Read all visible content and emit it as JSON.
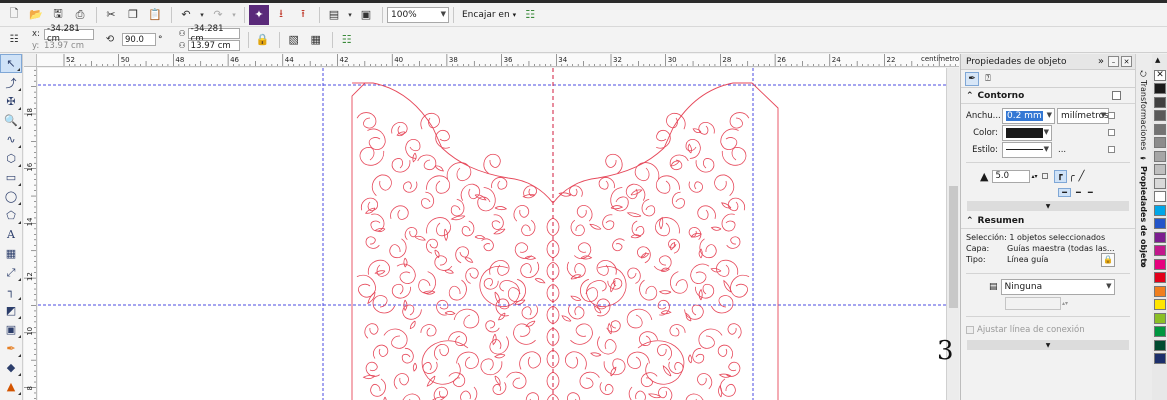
{
  "toolbar": {
    "zoom_value": "100%",
    "snap_label": "Encajar en"
  },
  "propbar": {
    "x_label": "x:",
    "x_value": "-34.281 cm",
    "y_label": "y:",
    "y_value": "13.97 cm",
    "angle_value": "90.0",
    "angle_unit": "°",
    "p1_value": "-34.281 cm",
    "p2_value": "13.97 cm"
  },
  "ruler": {
    "h_labels": [
      "52",
      "50",
      "48",
      "46",
      "44",
      "42",
      "40",
      "38",
      "36",
      "34",
      "32",
      "30",
      "28",
      "26",
      "24",
      "22"
    ],
    "unit": "centímetros",
    "v_labels": [
      "18",
      "16",
      "14",
      "12",
      "10",
      "8",
      "6"
    ]
  },
  "canvas": {
    "big_char": "3"
  },
  "docker": {
    "title": "Propiedades de objeto",
    "contorno": {
      "heading": "Contorno",
      "width_label": "Anchu...",
      "width_value": "0.2 mm",
      "unit_value": "milímetros",
      "color_label": "Color:",
      "style_label": "Estilo:",
      "style_more": "...",
      "miter_value": "5.0"
    },
    "resumen": {
      "heading": "Resumen",
      "selection_text": "Selección: 1 objetos seleccionados",
      "layer_label": "Capa:",
      "layer_value": "Guías maestra (todas las...",
      "type_label": "Tipo:",
      "type_value": "Línea guía",
      "line_type_value": "Ninguna",
      "connector_label": "Ajustar línea de conexión"
    }
  },
  "side_tabs": {
    "transform": "Transformaciones",
    "props": "Propiedades de objeto"
  },
  "colors": {
    "guide": "#4b4be0",
    "page_guide": "#d21b3c",
    "artwork": "#e6485a",
    "highlight": "#2f6bd6"
  },
  "palette": [
    "#1a1a1a",
    "#404040",
    "#595959",
    "#737373",
    "#8c8c8c",
    "#a6a6a6",
    "#bfbfbf",
    "#d9d9d9",
    "#ffffff",
    "#00a6e8",
    "#2355c9",
    "#7b1d8f",
    "#c2188c",
    "#e6007e",
    "#e2001a",
    "#f07f1e",
    "#ffe500",
    "#8bbf26",
    "#00963f",
    "#004a2f",
    "#1c2f6b"
  ]
}
